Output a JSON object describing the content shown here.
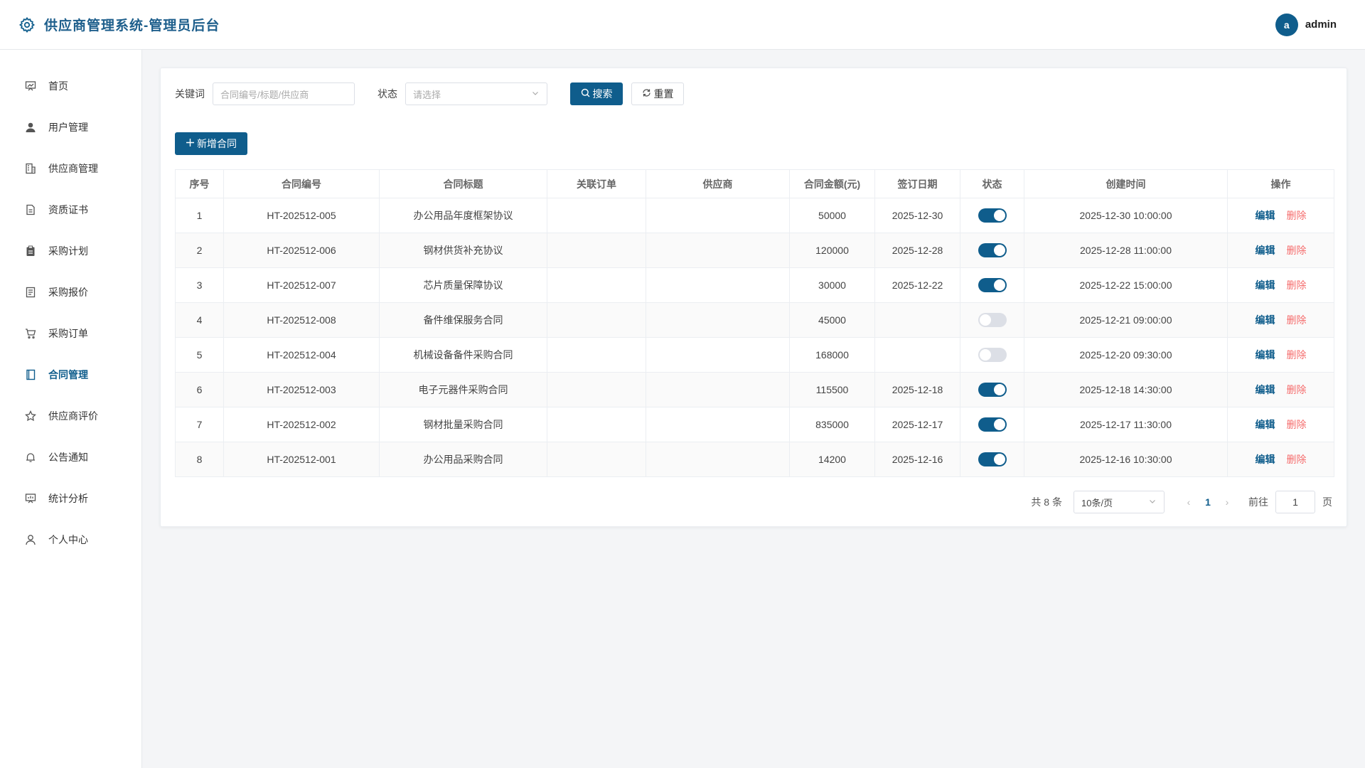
{
  "header": {
    "title": "供应商管理系统-管理员后台",
    "avatar_letter": "a",
    "username": "admin",
    "accent": "#0f5d8c"
  },
  "sidebar": {
    "items": [
      {
        "label": "首页",
        "icon": "chart-board-icon",
        "active": false
      },
      {
        "label": "用户管理",
        "icon": "user-icon",
        "active": false
      },
      {
        "label": "供应商管理",
        "icon": "office-building-icon",
        "active": false
      },
      {
        "label": "资质证书",
        "icon": "document-icon",
        "active": false
      },
      {
        "label": "采购计划",
        "icon": "clipboard-icon",
        "active": false
      },
      {
        "label": "采购报价",
        "icon": "tickets-icon",
        "active": false
      },
      {
        "label": "采购订单",
        "icon": "shopping-cart-icon",
        "active": false
      },
      {
        "label": "合同管理",
        "icon": "notebook-icon",
        "active": true
      },
      {
        "label": "供应商评价",
        "icon": "star-icon",
        "active": false
      },
      {
        "label": "公告通知",
        "icon": "bell-icon",
        "active": false
      },
      {
        "label": "统计分析",
        "icon": "data-board-icon",
        "active": false
      },
      {
        "label": "个人中心",
        "icon": "user-outline-icon",
        "active": false
      }
    ]
  },
  "filters": {
    "keyword_label": "关键词",
    "keyword_placeholder": "合同编号/标题/供应商",
    "status_label": "状态",
    "status_placeholder": "请选择",
    "search_label": "搜索",
    "reset_label": "重置"
  },
  "add_button_label": "新增合同",
  "table": {
    "columns": [
      "序号",
      "合同编号",
      "合同标题",
      "关联订单",
      "供应商",
      "合同金额(元)",
      "签订日期",
      "状态",
      "创建时间",
      "操作"
    ],
    "edit_label": "编辑",
    "delete_label": "删除",
    "rows": [
      {
        "idx": "1",
        "code": "HT-202512-005",
        "title": "办公用品年度框架协议",
        "order": "",
        "supplier": "",
        "amount": "50000",
        "date": "2025-12-30",
        "status_on": true,
        "created": "2025-12-30 10:00:00"
      },
      {
        "idx": "2",
        "code": "HT-202512-006",
        "title": "钢材供货补充协议",
        "order": "",
        "supplier": "",
        "amount": "120000",
        "date": "2025-12-28",
        "status_on": true,
        "created": "2025-12-28 11:00:00"
      },
      {
        "idx": "3",
        "code": "HT-202512-007",
        "title": "芯片质量保障协议",
        "order": "",
        "supplier": "",
        "amount": "30000",
        "date": "2025-12-22",
        "status_on": true,
        "created": "2025-12-22 15:00:00"
      },
      {
        "idx": "4",
        "code": "HT-202512-008",
        "title": "备件维保服务合同",
        "order": "",
        "supplier": "",
        "amount": "45000",
        "date": "",
        "status_on": false,
        "created": "2025-12-21 09:00:00"
      },
      {
        "idx": "5",
        "code": "HT-202512-004",
        "title": "机械设备备件采购合同",
        "order": "",
        "supplier": "",
        "amount": "168000",
        "date": "",
        "status_on": false,
        "created": "2025-12-20 09:30:00"
      },
      {
        "idx": "6",
        "code": "HT-202512-003",
        "title": "电子元器件采购合同",
        "order": "",
        "supplier": "",
        "amount": "115500",
        "date": "2025-12-18",
        "status_on": true,
        "created": "2025-12-18 14:30:00"
      },
      {
        "idx": "7",
        "code": "HT-202512-002",
        "title": "钢材批量采购合同",
        "order": "",
        "supplier": "",
        "amount": "835000",
        "date": "2025-12-17",
        "status_on": true,
        "created": "2025-12-17 11:30:00"
      },
      {
        "idx": "8",
        "code": "HT-202512-001",
        "title": "办公用品采购合同",
        "order": "",
        "supplier": "",
        "amount": "14200",
        "date": "2025-12-16",
        "status_on": true,
        "created": "2025-12-16 10:30:00"
      }
    ]
  },
  "pagination": {
    "total_text": "共 8 条",
    "page_size": "10条/页",
    "current_page": "1",
    "goto_label": "前往",
    "goto_value": "1",
    "page_suffix": "页"
  }
}
